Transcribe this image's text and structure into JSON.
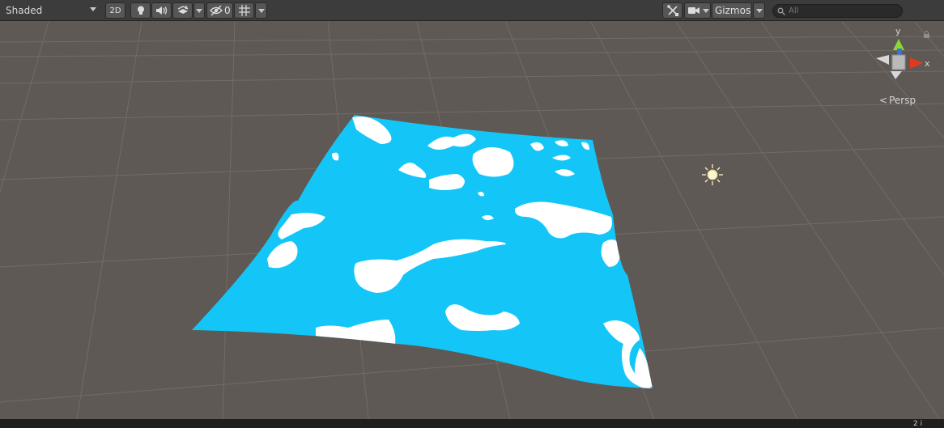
{
  "toolbar": {
    "draw_mode": "Shaded",
    "mode_2d": "2D",
    "hidden_count": "0",
    "gizmos_label": "Gizmos",
    "search_placeholder": "All"
  },
  "gizmo": {
    "axis_y": "y",
    "axis_x": "x",
    "projection": "Persp"
  },
  "status": {
    "corner_text": "2 i"
  },
  "colors": {
    "toolbar_bg": "#3c3c3c",
    "scene_bg": "#5f5955",
    "mesh_blue": "#14c6f7",
    "mesh_white": "#ffffff",
    "axis_y": "#8dd435",
    "axis_x": "#e33a1f",
    "axis_z": "#3a6fdc"
  },
  "icons": [
    "chevron-down-icon",
    "lightbulb-icon",
    "speaker-icon",
    "effects-icon",
    "scene-visibility-icon",
    "grid-icon",
    "tools-icon",
    "camera-icon",
    "search-icon",
    "lock-icon",
    "directional-light-icon",
    "orientation-gizmo"
  ]
}
